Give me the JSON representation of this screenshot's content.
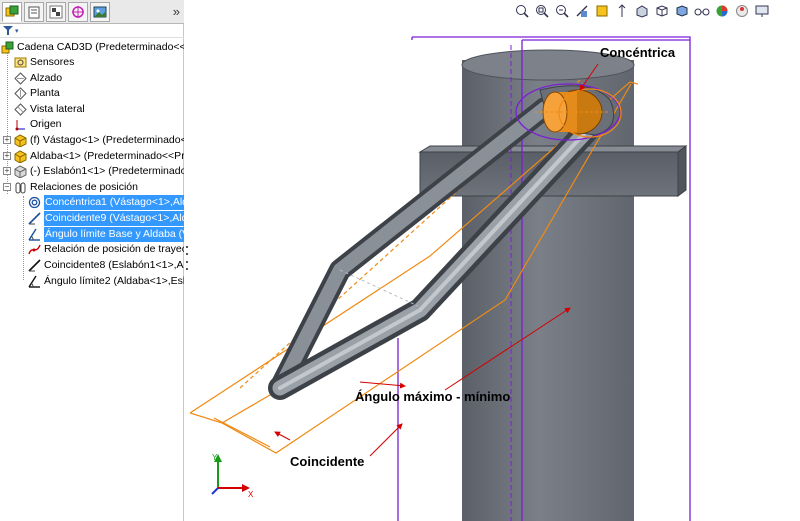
{
  "feature_tree": {
    "filter_icon": "filter-icon",
    "root": "Cadena CAD3D  (Predeterminado<<Pr",
    "items": [
      {
        "label": "Sensores",
        "icon": "sensors-icon"
      },
      {
        "label": "Alzado",
        "icon": "plane-icon"
      },
      {
        "label": "Planta",
        "icon": "plane-icon"
      },
      {
        "label": "Vista lateral",
        "icon": "plane-icon"
      },
      {
        "label": "Origen",
        "icon": "origin-icon"
      },
      {
        "label": "(f) Vástago<1> (Predeterminado<<Pr",
        "icon": "part-icon"
      },
      {
        "label": "Aldaba<1> (Predeterminado<<Pred",
        "icon": "part-icon"
      },
      {
        "label": "(-) Eslabón1<1> (Predeterminado<",
        "icon": "part-icon"
      },
      {
        "label": "Relaciones de posición",
        "icon": "mates-folder-icon"
      }
    ],
    "mates": [
      {
        "label": "Concéntrica1 (Vástago<1>,Alda",
        "icon": "concentric-mate-icon",
        "selected": true
      },
      {
        "label": "Coincidente9 (Vástago<1>,Alda",
        "icon": "coincident-mate-icon",
        "selected": true
      },
      {
        "label": "Ángulo límite Base y Aldaba (V",
        "icon": "angle-limit-mate-icon",
        "selected": true
      },
      {
        "label": "Relación de posición de trayec",
        "icon": "path-mate-icon",
        "selected": false
      },
      {
        "label": "Coincidente8 (Eslabón1<1>,A",
        "icon": "coincident-mate-icon",
        "selected": false
      },
      {
        "label": "Ángulo límite2 (Aldaba<1>,Esl",
        "icon": "angle-limit-mate-icon",
        "selected": false
      }
    ]
  },
  "viewport": {
    "annotations": {
      "concentric": "Concéntrica",
      "angle": "Ángulo máximo - mínimo",
      "coincident": "Coincidente"
    },
    "triad": {
      "y": "Y",
      "x": "X"
    },
    "colors": {
      "purple_plane": "#7a1fd6",
      "orange_edge": "#f08a14",
      "arrow_red": "#d40000",
      "part_gray": "#6a6f78"
    }
  }
}
